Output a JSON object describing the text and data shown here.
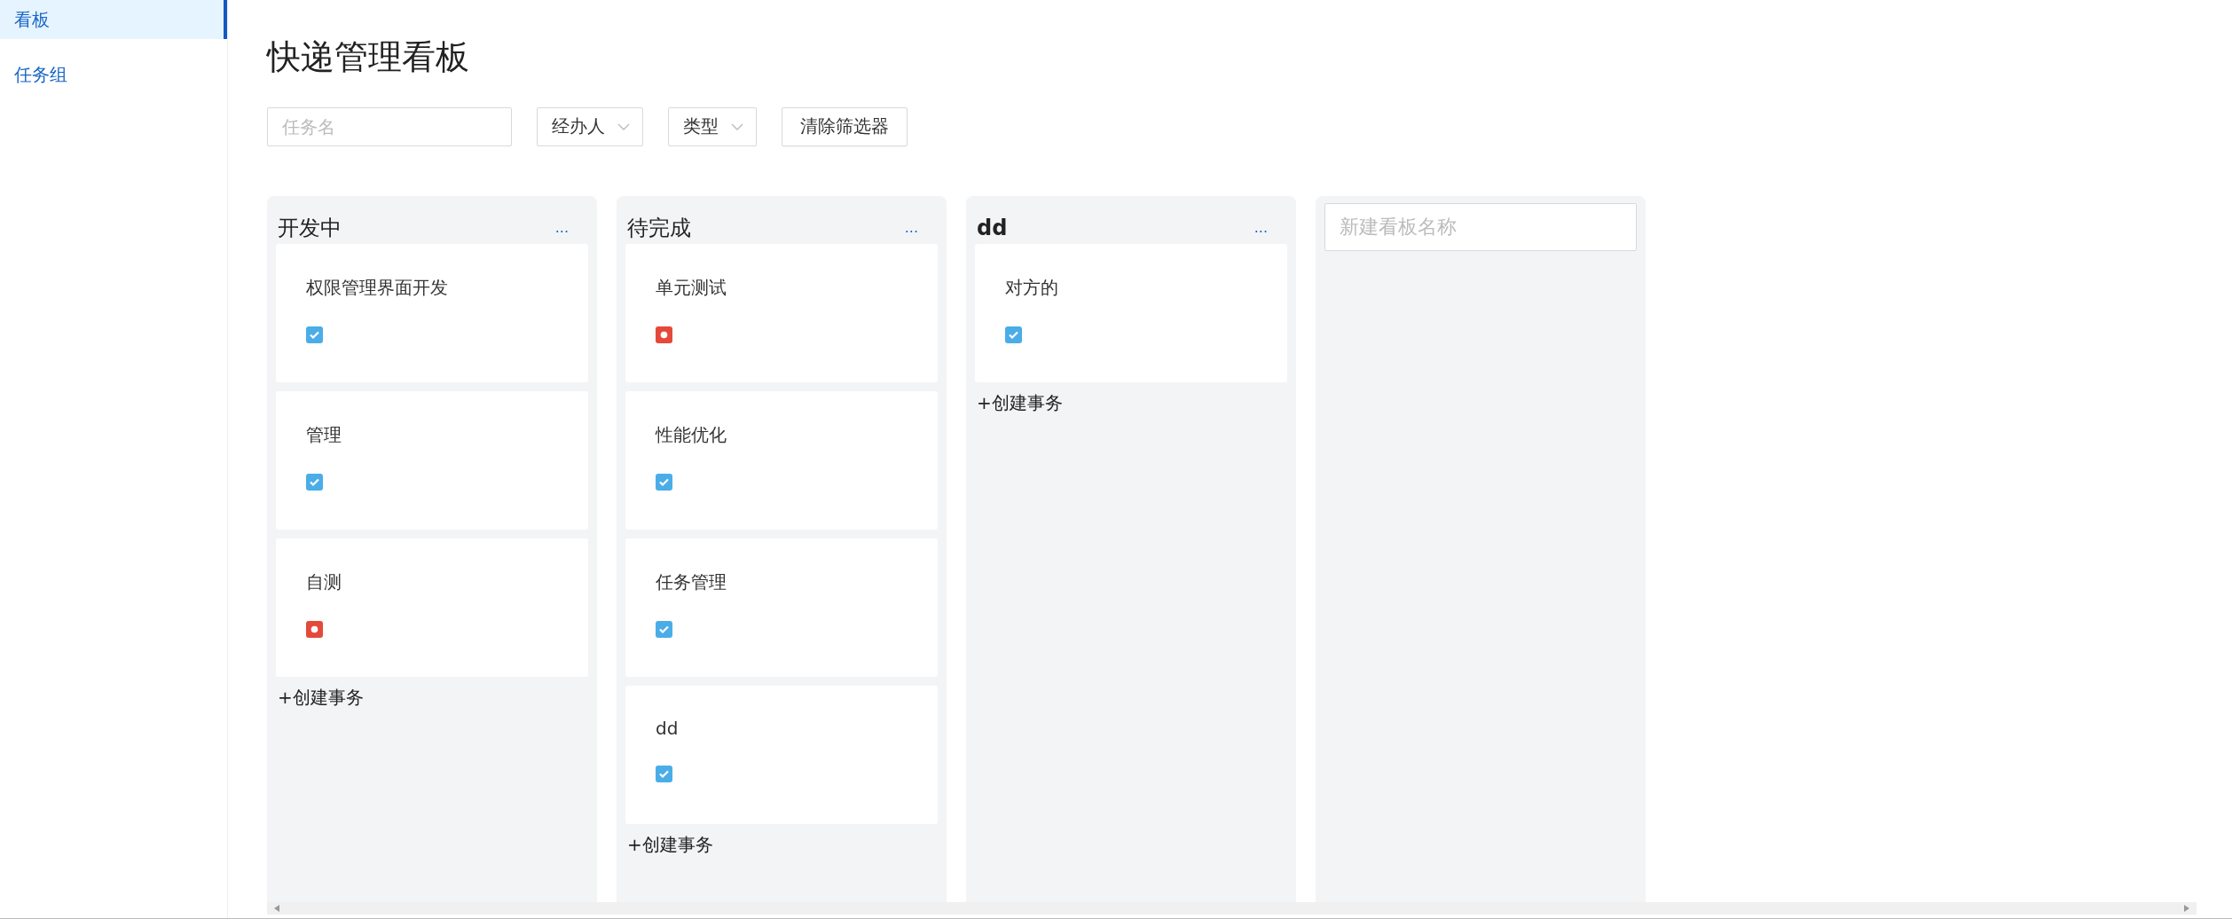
{
  "sidebar": {
    "items": [
      {
        "label": "看板",
        "selected": true
      },
      {
        "label": "任务组",
        "selected": false
      }
    ]
  },
  "title": "快递管理看板",
  "filters": {
    "search": {
      "placeholder": "任务名"
    },
    "selects": [
      "经办人",
      "类型"
    ],
    "clear_button": "清除筛选器"
  },
  "columns": [
    {
      "name": "开发中",
      "more": "...",
      "create": "+创建事务",
      "tasks": [
        {
          "name": "权限管理界面开发",
          "kind": "task"
        },
        {
          "name": "管理",
          "kind": "task"
        },
        {
          "name": "自测",
          "kind": "bug"
        }
      ]
    },
    {
      "name": "待完成",
      "more": "...",
      "create": "+创建事务",
      "tasks": [
        {
          "name": "单元测试",
          "kind": "bug"
        },
        {
          "name": "性能优化",
          "kind": "task"
        },
        {
          "name": "任务管理",
          "kind": "task"
        },
        {
          "name": "dd",
          "kind": "task"
        }
      ]
    },
    {
      "name": "dd",
      "more": "...",
      "create": "+创建事务",
      "tasks": [
        {
          "name": "对方的",
          "kind": "task"
        }
      ]
    }
  ],
  "new_board": {
    "placeholder": "新建看板名称"
  }
}
